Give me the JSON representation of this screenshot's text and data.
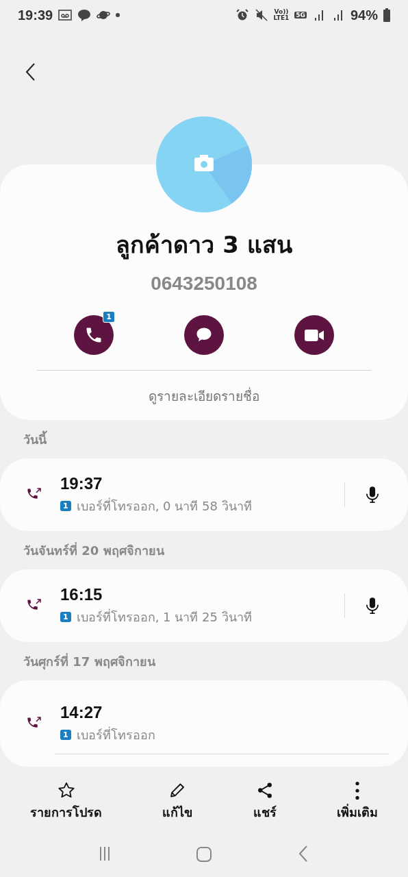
{
  "status_bar": {
    "time": "19:39",
    "volte": "Vo))",
    "lte": "LTE1",
    "network": "5G",
    "battery": "94%"
  },
  "contact": {
    "name": "ลูกค้าดาว 3 แสน",
    "phone": "0643250108",
    "call_badge": "1",
    "details_link": "ดูรายละเอียดรายชื่อ"
  },
  "history": [
    {
      "date": "วันนี้",
      "time": "19:37",
      "sim": "1",
      "detail": "เบอร์ที่โทรออก, 0 นาที 58 วินาที",
      "recording": true,
      "divider": false
    },
    {
      "date": "วันจันทร์ที่ 20 พฤศจิกายน",
      "time": "16:15",
      "sim": "1",
      "detail": "เบอร์ที่โทรออก, 1 นาที 25 วินาที",
      "recording": true,
      "divider": false
    },
    {
      "date": "วันศุกร์ที่ 17 พฤศจิกายน",
      "time": "14:27",
      "sim": "1",
      "detail": "เบอร์ที่โทรออก",
      "recording": false,
      "divider": true
    }
  ],
  "bottom_actions": [
    {
      "kind": "star",
      "label": "รายการโปรด"
    },
    {
      "kind": "edit",
      "label": "แก้ไข"
    },
    {
      "kind": "share",
      "label": "แชร์"
    },
    {
      "kind": "more",
      "label": "เพิ่มเติม"
    }
  ]
}
